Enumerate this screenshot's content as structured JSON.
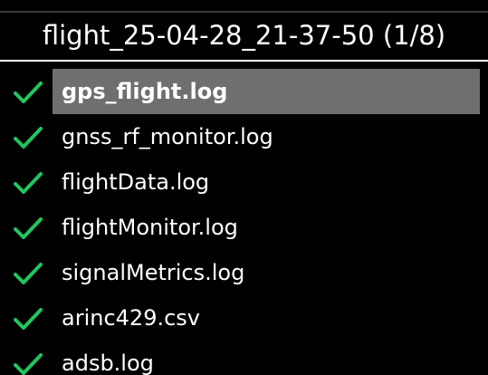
{
  "header": {
    "title": "flight_25-04-28_21-37-50 (1/8)"
  },
  "colors": {
    "background": "#000000",
    "text": "#ffffff",
    "check": "#22c55e",
    "selection": "#6f6f6f"
  },
  "files": [
    {
      "name": "gps_flight.log",
      "checked": true,
      "selected": true,
      "icon": "checkmark-icon"
    },
    {
      "name": "gnss_rf_monitor.log",
      "checked": true,
      "selected": false,
      "icon": "checkmark-icon"
    },
    {
      "name": "flightData.log",
      "checked": true,
      "selected": false,
      "icon": "checkmark-icon"
    },
    {
      "name": "flightMonitor.log",
      "checked": true,
      "selected": false,
      "icon": "checkmark-icon"
    },
    {
      "name": "signalMetrics.log",
      "checked": true,
      "selected": false,
      "icon": "checkmark-icon"
    },
    {
      "name": "arinc429.csv",
      "checked": true,
      "selected": false,
      "icon": "checkmark-icon"
    },
    {
      "name": "adsb.log",
      "checked": true,
      "selected": false,
      "icon": "checkmark-icon"
    }
  ]
}
